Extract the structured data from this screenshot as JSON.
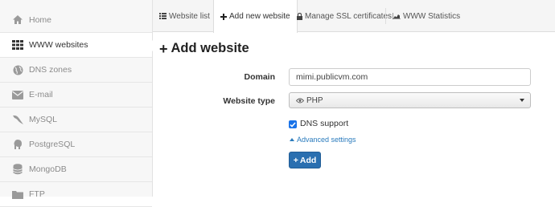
{
  "sidebar": {
    "items": [
      {
        "label": "Home",
        "icon": "home-icon"
      },
      {
        "label": "WWW websites",
        "icon": "grid-icon",
        "active": true
      },
      {
        "label": "DNS zones",
        "icon": "globe-icon"
      },
      {
        "label": "E-mail",
        "icon": "envelope-icon"
      },
      {
        "label": "MySQL",
        "icon": "dolphin-icon"
      },
      {
        "label": "PostgreSQL",
        "icon": "elephant-icon"
      },
      {
        "label": "MongoDB",
        "icon": "database-icon"
      },
      {
        "label": "FTP",
        "icon": "folder-icon"
      }
    ]
  },
  "tabs": [
    {
      "label": "Website list",
      "icon": "list-icon"
    },
    {
      "label": "Add new website",
      "icon": "plus-icon",
      "active": true
    },
    {
      "label": "Manage SSL certificates",
      "icon": "lock-icon"
    },
    {
      "label": "WWW Statistics",
      "icon": "chart-icon"
    }
  ],
  "main": {
    "title": "Add website",
    "domain_label": "Domain",
    "domain_value": "mimi.publicvm.com",
    "type_label": "Website type",
    "type_value": "PHP",
    "dns_label": "DNS support",
    "dns_checked": true,
    "advanced_label": "Advanced settings",
    "add_label": "Add"
  },
  "colors": {
    "accent": "#2a6fb0",
    "link": "#2a7bbd",
    "checkbox": "#1a73e8"
  }
}
